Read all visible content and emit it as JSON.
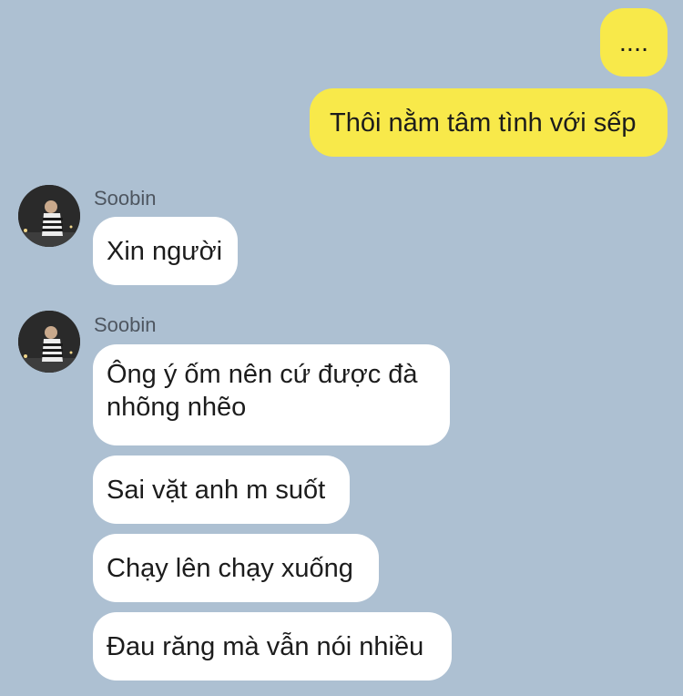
{
  "colors": {
    "background": "#adc0d2",
    "outgoing_bubble": "#f8e94a",
    "incoming_bubble": "#ffffff"
  },
  "messages_out": [
    {
      "text": "...."
    },
    {
      "text": "Thôi nằm tâm tình với sếp"
    }
  ],
  "group1": {
    "sender": "Soobin",
    "avatar_icon": "profile-photo-avatar",
    "messages": [
      {
        "text": "Xin người"
      }
    ]
  },
  "group2": {
    "sender": "Soobin",
    "avatar_icon": "profile-photo-avatar",
    "messages": [
      {
        "text": "Ông ý ốm nên cứ được đà nhõng nhẽo"
      },
      {
        "text": "Sai vặt anh m suốt"
      },
      {
        "text": "Chạy lên chạy xuống"
      },
      {
        "text": "Đau răng mà vẫn nói nhiều"
      }
    ]
  }
}
